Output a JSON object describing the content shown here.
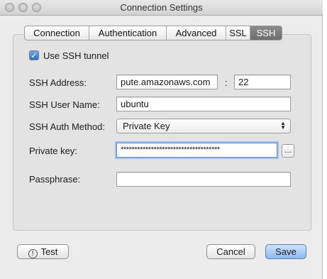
{
  "window": {
    "title": "Connection Settings"
  },
  "tabs": [
    {
      "label": "Connection"
    },
    {
      "label": "Authentication"
    },
    {
      "label": "Advanced"
    },
    {
      "label": "SSL"
    },
    {
      "label": "SSH",
      "active": true
    }
  ],
  "ssh": {
    "use_tunnel_label": "Use SSH tunnel",
    "use_tunnel_checked": true,
    "address_label": "SSH Address:",
    "address_value": "pute.amazonaws.com",
    "port_separator": ":",
    "port_value": "22",
    "user_label": "SSH User Name:",
    "user_value": "ubuntu",
    "auth_method_label": "SSH Auth Method:",
    "auth_method_value": "Private Key",
    "private_key_label": "Private key:",
    "private_key_value": "************************************",
    "browse_label": "...",
    "passphrase_label": "Passphrase:",
    "passphrase_value": ""
  },
  "footer": {
    "test_label": "Test",
    "test_icon": "!",
    "cancel_label": "Cancel",
    "save_label": "Save"
  },
  "colors": {
    "accent": "#8fb8ee",
    "focus_ring": "#9cc0ef"
  }
}
